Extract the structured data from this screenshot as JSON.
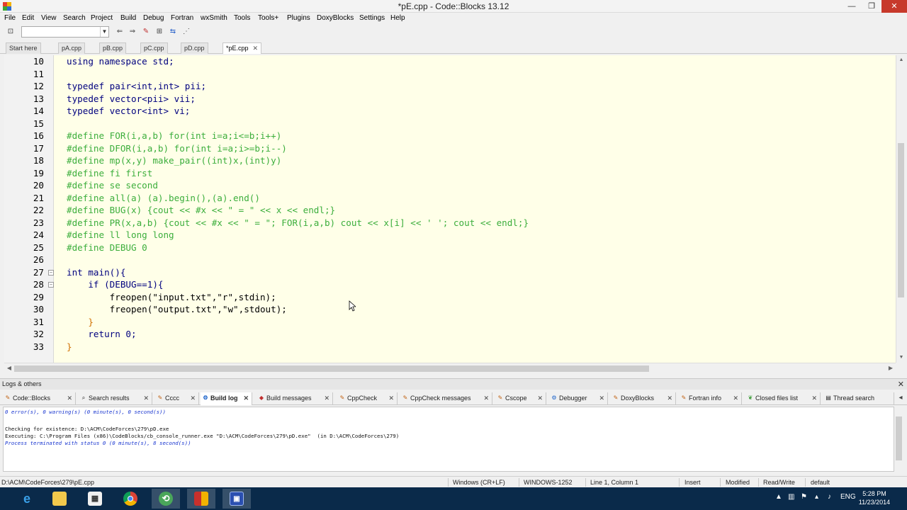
{
  "window": {
    "title": "*pE.cpp - Code::Blocks 13.12",
    "controls": {
      "minimize": "—",
      "maximize": "❐",
      "close": "✕"
    }
  },
  "menu": [
    "File",
    "Edit",
    "View",
    "Search",
    "Project",
    "Build",
    "Debug",
    "Fortran",
    "wxSmith",
    "Tools",
    "Tools+",
    "Plugins",
    "DoxyBlocks",
    "Settings",
    "Help"
  ],
  "editor_tabs": [
    {
      "label": "Start here",
      "active": false,
      "closable": false
    },
    {
      "label": "pA.cpp",
      "active": false,
      "closable": false
    },
    {
      "label": "pB.cpp",
      "active": false,
      "closable": false
    },
    {
      "label": "pC.cpp",
      "active": false,
      "closable": false
    },
    {
      "label": "pD.cpp",
      "active": false,
      "closable": false
    },
    {
      "label": "*pE.cpp",
      "active": true,
      "closable": true
    }
  ],
  "code": {
    "line_numbers": [
      "10",
      "11",
      "12",
      "13",
      "14",
      "15",
      "16",
      "17",
      "18",
      "19",
      "20",
      "21",
      "22",
      "23",
      "24",
      "25",
      "26",
      "27",
      "28",
      "29",
      "30",
      "31",
      "32",
      "33"
    ],
    "lines": [
      "using namespace std;",
      "",
      "typedef pair<int,int> pii;",
      "typedef vector<pii> vii;",
      "typedef vector<int> vi;",
      "",
      "#define FOR(i,a,b) for(int i=a;i<=b;i++)",
      "#define DFOR(i,a,b) for(int i=a;i>=b;i--)",
      "#define mp(x,y) make_pair((int)x,(int)y)",
      "#define fi first",
      "#define se second",
      "#define all(a) (a).begin(),(a).end()",
      "#define BUG(x) {cout << #x << \" = \" << x << endl;}",
      "#define PR(x,a,b) {cout << #x << \" = \"; FOR(i,a,b) cout << x[i] << ' '; cout << endl;}",
      "#define ll long long",
      "#define DEBUG 0",
      "",
      "int main(){",
      "    if (DEBUG==1){",
      "        freopen(\"input.txt\",\"r\",stdin);",
      "        freopen(\"output.txt\",\"w\",stdout);",
      "    }",
      "    return 0;",
      "}"
    ]
  },
  "logs": {
    "title": "Logs & others",
    "tabs": [
      {
        "label": "Code::Blocks",
        "icon": "codeblocks-icon",
        "active": false
      },
      {
        "label": "Search results",
        "icon": "search-icon",
        "active": false
      },
      {
        "label": "Cccc",
        "icon": "pencil-icon",
        "active": false
      },
      {
        "label": "Build log",
        "icon": "gear-icon",
        "active": true
      },
      {
        "label": "Build messages",
        "icon": "bookmark-icon",
        "active": false
      },
      {
        "label": "CppCheck",
        "icon": "pencil-icon",
        "active": false
      },
      {
        "label": "CppCheck messages",
        "icon": "pencil-icon",
        "active": false
      },
      {
        "label": "Cscope",
        "icon": "pencil-icon",
        "active": false
      },
      {
        "label": "Debugger",
        "icon": "gear-icon",
        "active": false
      },
      {
        "label": "DoxyBlocks",
        "icon": "pencil-icon",
        "active": false
      },
      {
        "label": "Fortran info",
        "icon": "pencil-icon",
        "active": false
      },
      {
        "label": "Closed files list",
        "icon": "leaf-icon",
        "active": false
      },
      {
        "label": "Thread search",
        "icon": "file-icon",
        "active": false
      }
    ],
    "lines": [
      "0 error(s), 0 warning(s) (0 minute(s), 0 second(s))",
      "",
      "Checking for existence: D:\\ACM\\CodeForces\\279\\pD.exe",
      "Executing: C:\\Program Files (x86)\\CodeBlocks/cb_console_runner.exe \"D:\\ACM\\CodeForces\\279\\pD.exe\"  (in D:\\ACM\\CodeForces\\279)",
      "Process terminated with status 0 (0 minute(s), 8 second(s))"
    ]
  },
  "status": {
    "path": "D:\\ACM\\CodeForces\\279\\pE.cpp",
    "eol": "Windows (CR+LF)",
    "encoding": "WINDOWS-1252",
    "position": "Line 1, Column 1",
    "mode": "Insert",
    "modified": "Modified",
    "rw": "Read/Write",
    "profile": "default"
  },
  "taskbar": {
    "apps": [
      "internet-explorer",
      "file-explorer",
      "calculator",
      "chrome",
      "codeblocks",
      "winrar",
      "vs"
    ],
    "tray_lang": "ENG",
    "time": "5:28 PM",
    "date": "11/23/2014"
  },
  "colors": {
    "editor_bg": "#ffffe8",
    "keyword": "#00007f",
    "preprocessor": "#3cae3c",
    "string": "#2040c0",
    "number": "#d08000",
    "taskbar": "#0a2a4a"
  }
}
